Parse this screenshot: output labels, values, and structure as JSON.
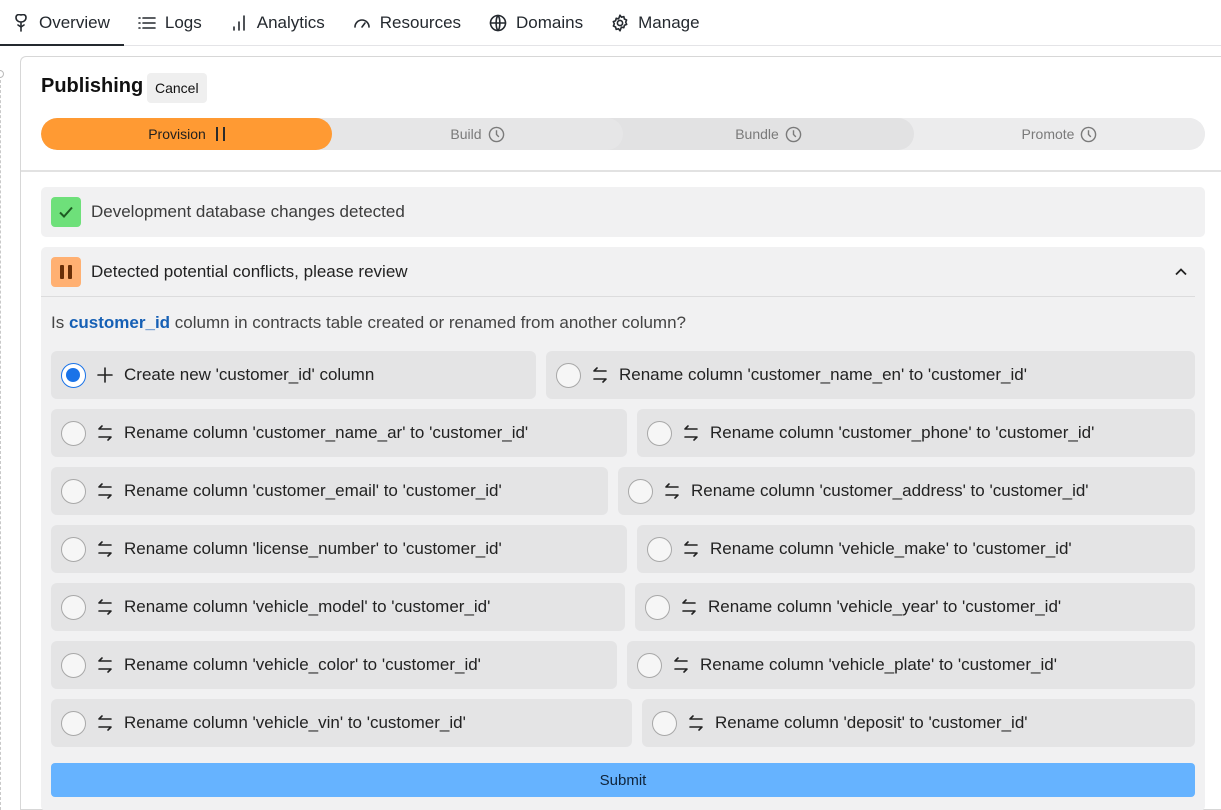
{
  "nav": {
    "tabs": [
      {
        "label": "Overview",
        "icon": "tree-icon"
      },
      {
        "label": "Logs",
        "icon": "list-icon"
      },
      {
        "label": "Analytics",
        "icon": "bar-chart-icon"
      },
      {
        "label": "Resources",
        "icon": "gauge-icon"
      },
      {
        "label": "Domains",
        "icon": "globe-icon"
      },
      {
        "label": "Manage",
        "icon": "gear-icon"
      }
    ],
    "active": "Overview"
  },
  "publishing": {
    "title": "Publishing",
    "cancel_label": "Cancel",
    "steps": [
      {
        "label": "Provision",
        "status": "paused"
      },
      {
        "label": "Build",
        "status": "pending"
      },
      {
        "label": "Bundle",
        "status": "pending"
      },
      {
        "label": "Promote",
        "status": "pending"
      }
    ]
  },
  "detected": {
    "text": "Development database changes detected"
  },
  "conflicts": {
    "text": "Detected potential conflicts, please review",
    "question_prefix": "Is",
    "question_column": "customer_id",
    "question_suffix": "column in contracts table created or renamed from another column?",
    "options": [
      "Create new 'customer_id' column",
      "Rename column 'customer_name_en' to 'customer_id'",
      "Rename column 'customer_name_ar' to 'customer_id'",
      "Rename column 'customer_phone' to 'customer_id'",
      "Rename column 'customer_email' to 'customer_id'",
      "Rename column 'customer_address' to 'customer_id'",
      "Rename column 'license_number' to 'customer_id'",
      "Rename column 'vehicle_make' to 'customer_id'",
      "Rename column 'vehicle_model' to 'customer_id'",
      "Rename column 'vehicle_year' to 'customer_id'",
      "Rename column 'vehicle_color' to 'customer_id'",
      "Rename column 'vehicle_plate' to 'customer_id'",
      "Rename column 'vehicle_vin' to 'customer_id'",
      "Rename column 'deposit' to 'customer_id'"
    ],
    "selected_option": "Create new 'customer_id' column",
    "submit_label": "Submit"
  },
  "colors": {
    "accent_orange": "#ff9a33",
    "success_green": "#6ee07a",
    "radio_blue": "#1a73e8",
    "submit_blue": "#66b3ff",
    "link_blue": "#1660b5"
  }
}
